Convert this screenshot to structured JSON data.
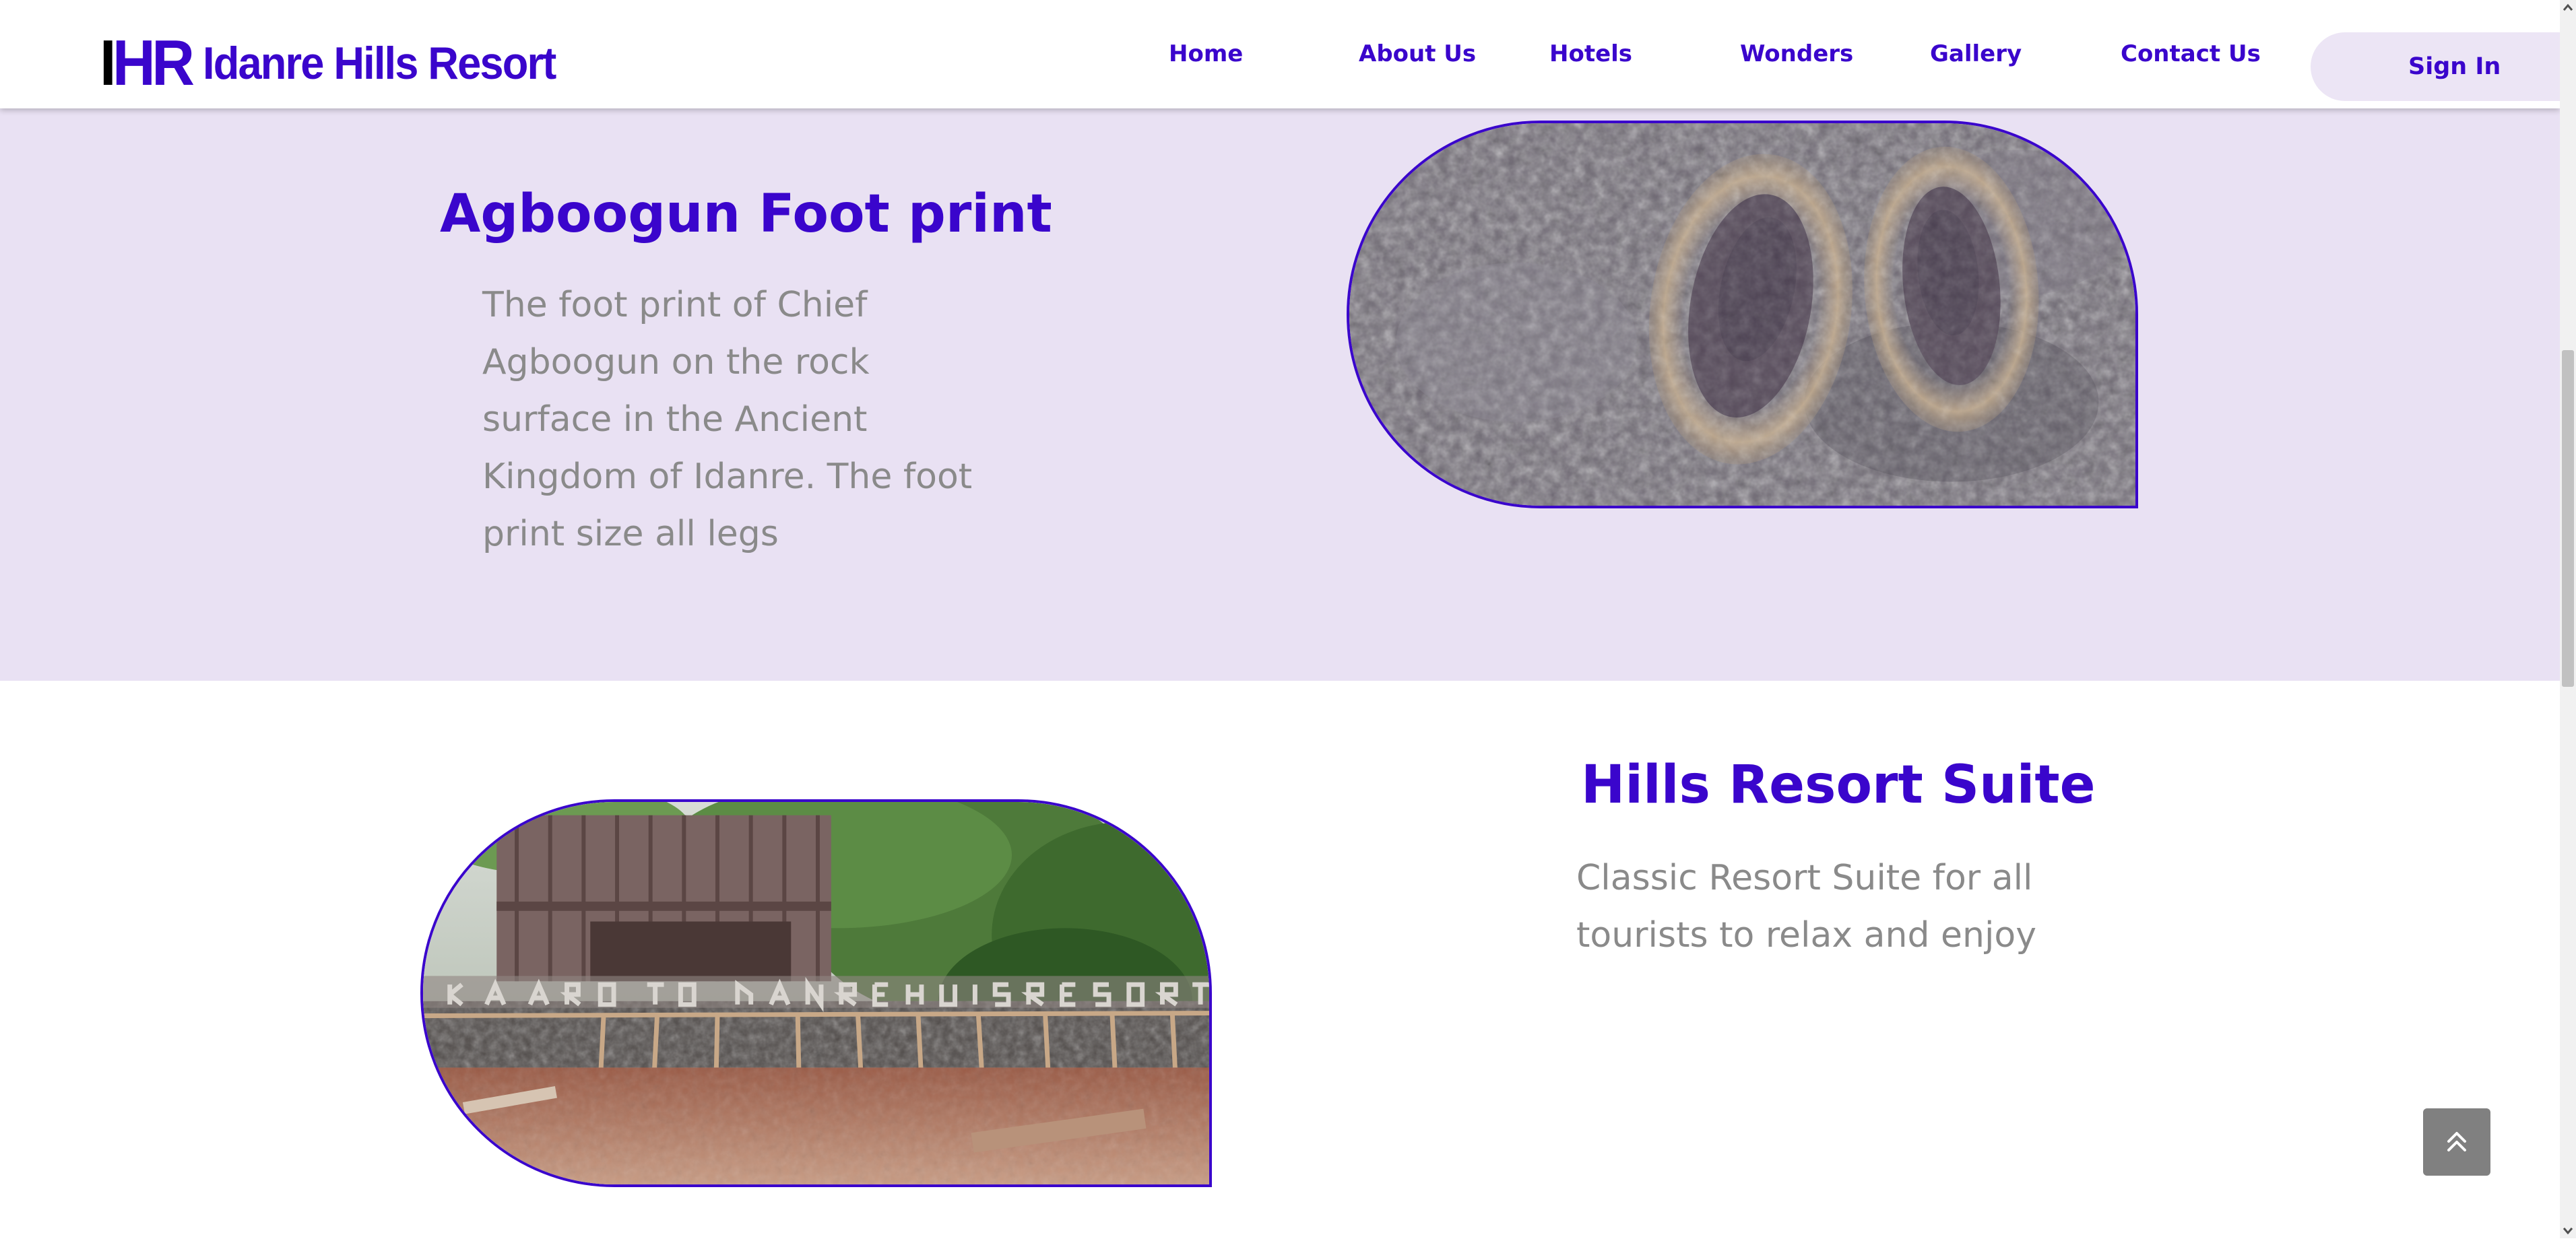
{
  "header": {
    "logo_mark_a": "I",
    "logo_mark_b": "HR",
    "logo_name": "Idanre Hills Resort",
    "nav": [
      {
        "label": "Home"
      },
      {
        "label": "About Us"
      },
      {
        "label": "Hotels"
      },
      {
        "label": "Wonders"
      },
      {
        "label": "Gallery"
      },
      {
        "label": "Contact Us"
      }
    ],
    "signin_label": "Sign In"
  },
  "sections": [
    {
      "title": "Agboogun Foot print",
      "description": "The foot print of Chief Agboogun on the rock surface in the Ancient Kingdom of Idanre. The foot print size all legs"
    },
    {
      "title": "Hills Resort Suite",
      "description": "Classic Resort Suite for all tourists to relax and enjoy"
    }
  ],
  "colors": {
    "brand": "#3A05CC",
    "section_bg": "#E9E1F3",
    "text_muted": "#8A8A8A",
    "button_bg": "#ECE5F5"
  },
  "icons": {
    "back_to_top": "double-chevron-up-icon",
    "scroll_up": "scroll-up-arrow-icon",
    "scroll_down": "scroll-down-arrow-icon"
  }
}
